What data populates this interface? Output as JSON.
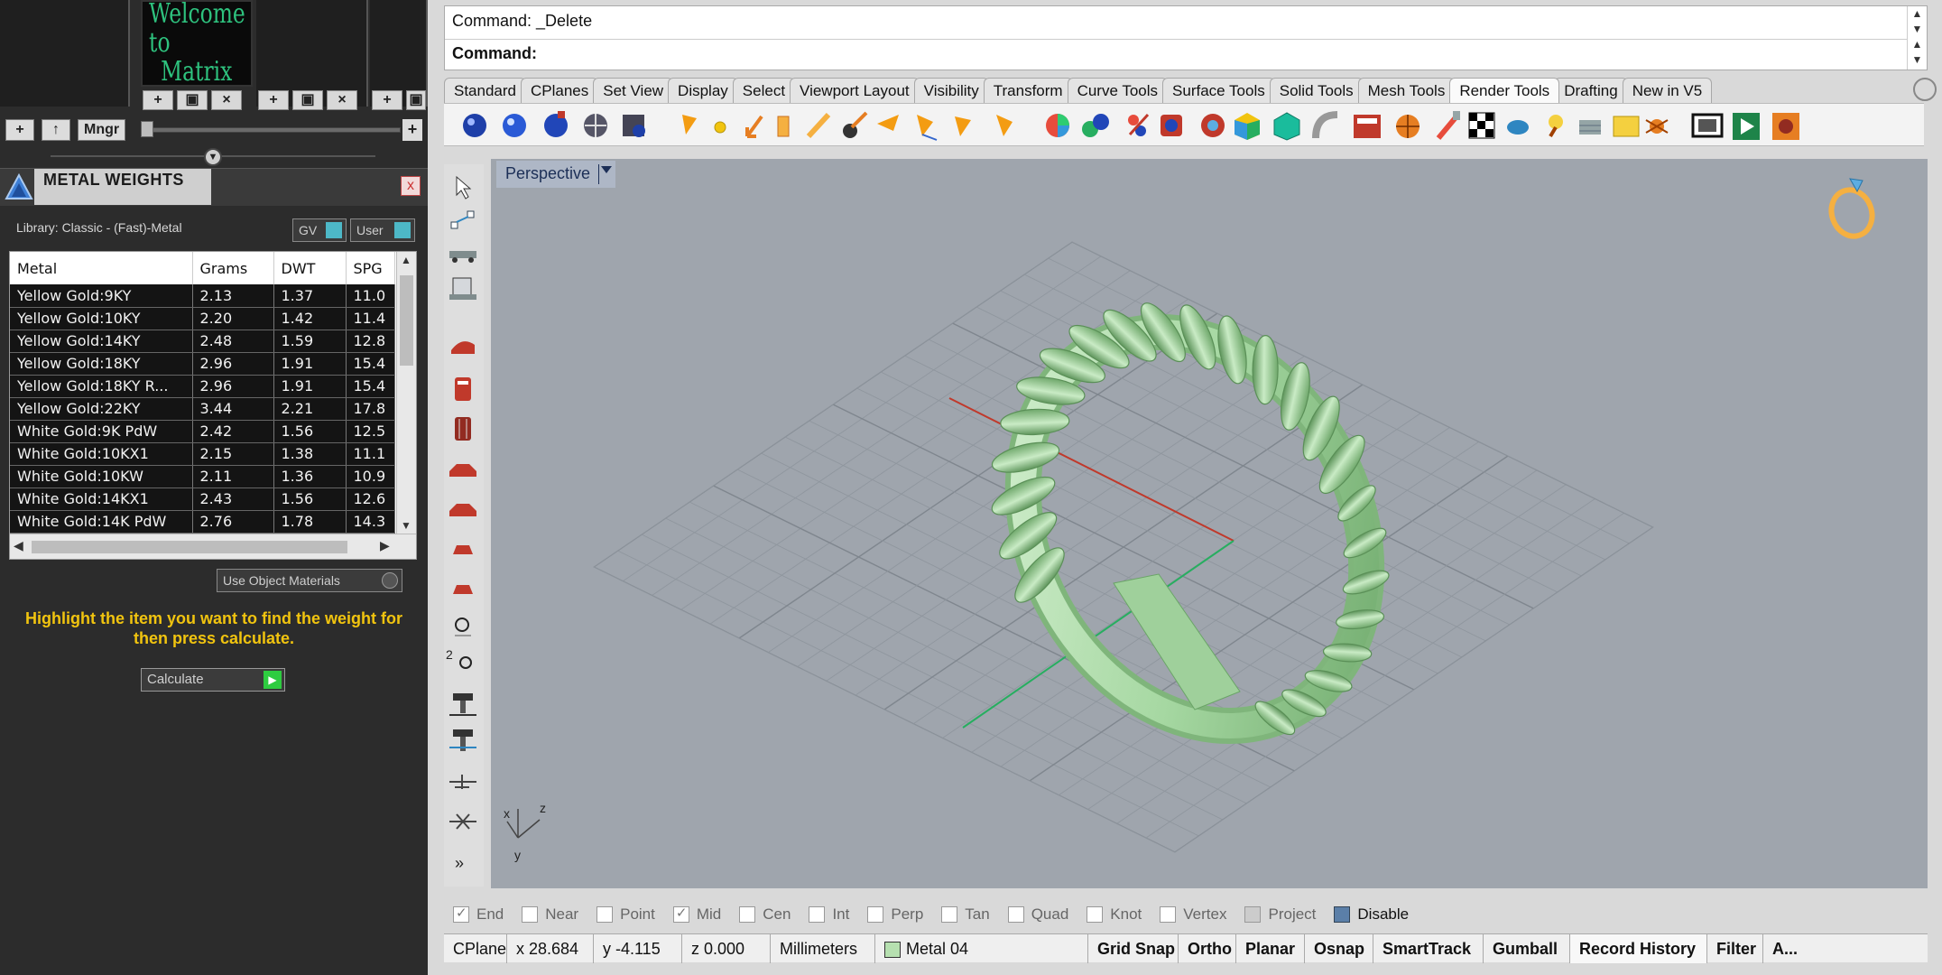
{
  "matrix_panel": {
    "welcome_line1": "Welcome to",
    "welcome_line2": "Matrix",
    "mngr_label": "Mngr"
  },
  "metal_weights": {
    "title": "METAL WEIGHTS",
    "close_label": "x",
    "library_label": "Library: Classic - (Fast)-Metal",
    "gv_label": "GV",
    "user_label": "User",
    "columns": [
      "Metal",
      "Grams",
      "DWT",
      "SPG"
    ],
    "rows": [
      [
        "Yellow Gold:9KY",
        "2.13",
        "1.37",
        "11.0"
      ],
      [
        "Yellow Gold:10KY",
        "2.20",
        "1.42",
        "11.4"
      ],
      [
        "Yellow Gold:14KY",
        "2.48",
        "1.59",
        "12.8"
      ],
      [
        "Yellow Gold:18KY",
        "2.96",
        "1.91",
        "15.4"
      ],
      [
        "Yellow Gold:18KY R...",
        "2.96",
        "1.91",
        "15.4"
      ],
      [
        "Yellow Gold:22KY",
        "3.44",
        "2.21",
        "17.8"
      ],
      [
        "White Gold:9K PdW",
        "2.42",
        "1.56",
        "12.5"
      ],
      [
        "White Gold:10KX1",
        "2.15",
        "1.38",
        "11.1"
      ],
      [
        "White Gold:10KW",
        "2.11",
        "1.36",
        "10.9"
      ],
      [
        "White Gold:14KX1",
        "2.43",
        "1.56",
        "12.6"
      ],
      [
        "White Gold:14K PdW",
        "2.76",
        "1.78",
        "14.3"
      ]
    ],
    "use_object_materials": "Use Object Materials",
    "hint": "Highlight the item you want to find the weight for then press calculate.",
    "calculate_label": "Calculate"
  },
  "command": {
    "line1": "Command: _Delete",
    "line2": "Command:"
  },
  "tabs": [
    "Standard",
    "CPlanes",
    "Set View",
    "Display",
    "Select",
    "Viewport Layout",
    "Visibility",
    "Transform",
    "Curve Tools",
    "Surface Tools",
    "Solid Tools",
    "Mesh Tools",
    "Render Tools",
    "Drafting",
    "New in V5"
  ],
  "active_tab": "Render Tools",
  "viewport": {
    "name": "Perspective",
    "axis_x": "x",
    "axis_y": "y",
    "axis_z": "z"
  },
  "osnap": {
    "items": [
      {
        "label": "End",
        "checked": true
      },
      {
        "label": "Near",
        "checked": false
      },
      {
        "label": "Point",
        "checked": false
      },
      {
        "label": "Mid",
        "checked": true
      },
      {
        "label": "Cen",
        "checked": false
      },
      {
        "label": "Int",
        "checked": false
      },
      {
        "label": "Perp",
        "checked": false
      },
      {
        "label": "Tan",
        "checked": false
      },
      {
        "label": "Quad",
        "checked": false
      },
      {
        "label": "Knot",
        "checked": false
      },
      {
        "label": "Vertex",
        "checked": false
      },
      {
        "label": "Project",
        "checked": false
      },
      {
        "label": "Disable",
        "checked": false
      }
    ]
  },
  "status": {
    "cplane": "CPlane",
    "x": "x 28.684",
    "y": "y -4.115",
    "z": "z 0.000",
    "units": "Millimeters",
    "layer": "Metal 04",
    "grid_snap": "Grid Snap",
    "ortho": "Ortho",
    "planar": "Planar",
    "osnap": "Osnap",
    "smarttrack": "SmartTrack",
    "gumball": "Gumball",
    "record_history": "Record History",
    "filter": "Filter",
    "more": "A..."
  },
  "colors": {
    "viewport_bg": "#9fa5ad",
    "ring": "#a6d8a2",
    "hint_text": "#f1c40f",
    "x_axis": "#c0392b",
    "y_axis": "#27ae60"
  }
}
